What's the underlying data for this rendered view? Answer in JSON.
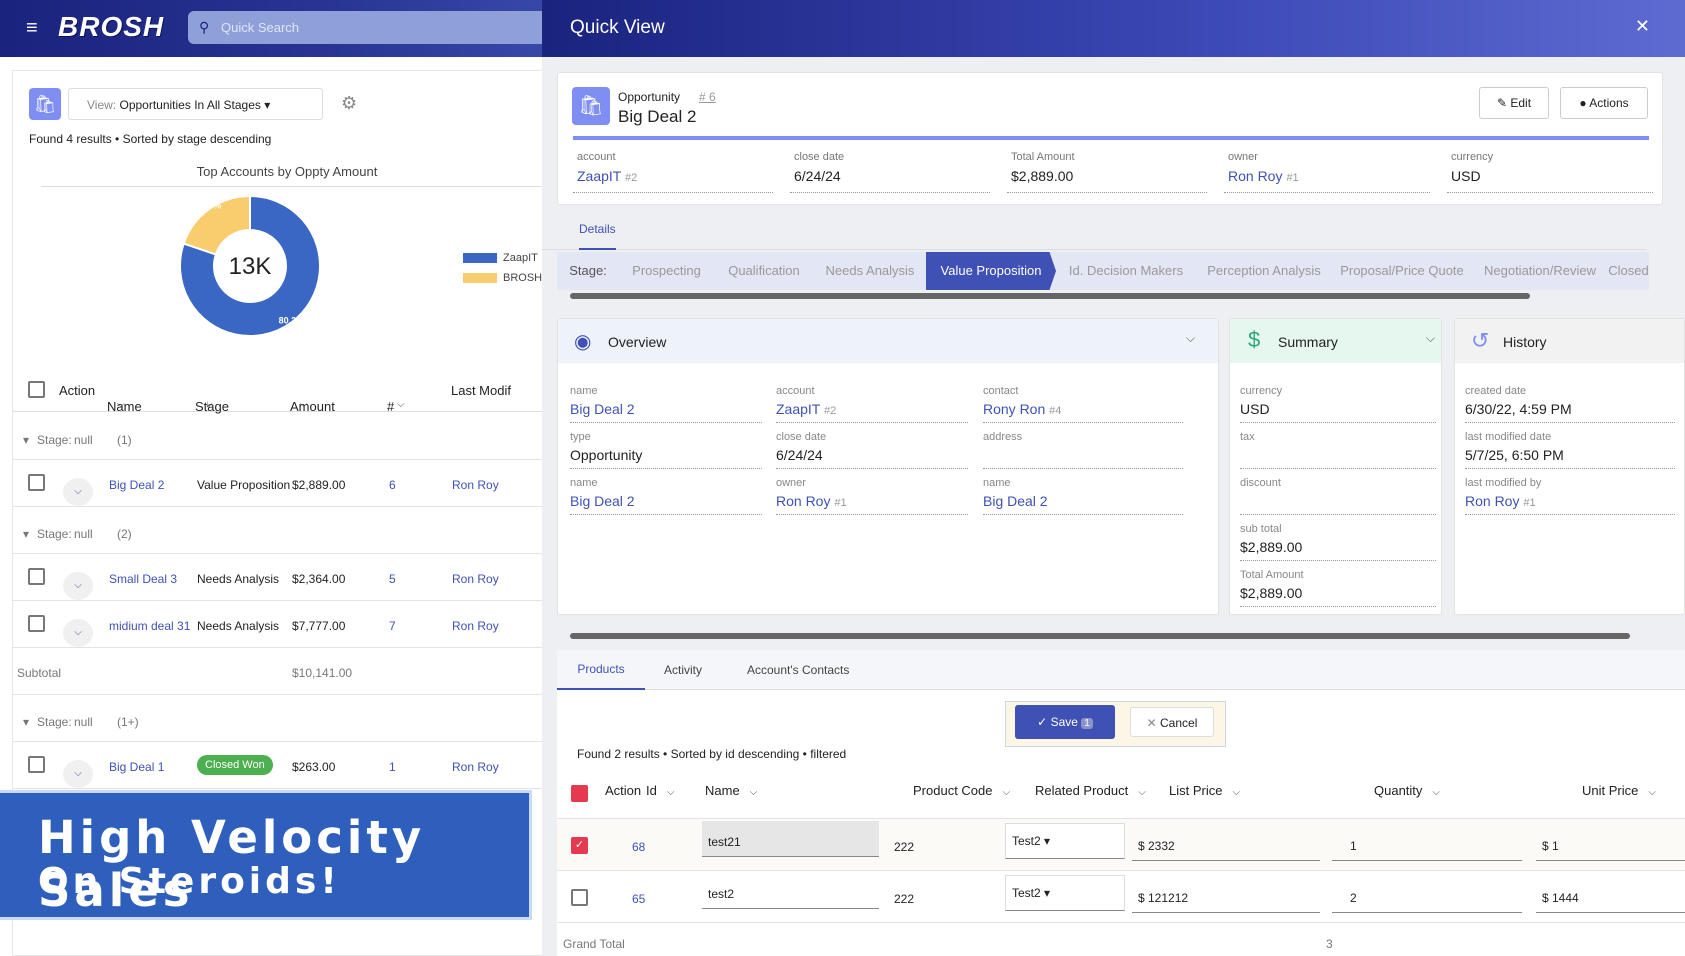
{
  "app": {
    "logo": "BROSH",
    "search_placeholder": "Quick Search"
  },
  "list": {
    "view_label": "View:",
    "view_value": "Opportunities In All Stages",
    "found": "Found 4 results • Sorted by stage descending",
    "chart_title": "Top Accounts by Oppty Amount",
    "headers": {
      "action": "Action",
      "name": "Name",
      "stage": "Stage",
      "amount": "Amount",
      "num": "#",
      "last": "Last Modif"
    },
    "groups": [
      {
        "label": "Stage:",
        "value": "null",
        "count": "(1)"
      },
      {
        "label": "Stage:",
        "value": "null",
        "count": "(2)"
      },
      {
        "label": "Stage:",
        "value": "null",
        "count": "(1+)"
      }
    ],
    "rows": [
      {
        "name": "Big Deal 2",
        "stage": "Value Proposition",
        "amount": "$2,889.00",
        "num": "6",
        "owner": "Ron Roy"
      },
      {
        "name": "Small Deal 3",
        "stage": "Needs Analysis",
        "amount": "$2,364.00",
        "num": "5",
        "owner": "Ron Roy"
      },
      {
        "name": "midium deal 31",
        "stage": "Needs Analysis",
        "amount": "$7,777.00",
        "num": "7",
        "owner": "Ron Roy"
      },
      {
        "name": "Big Deal 1",
        "stage": "Closed Won",
        "amount": "$263.00",
        "num": "1",
        "owner": "Ron Roy"
      }
    ],
    "subtotal_label": "Subtotal",
    "subtotal_value": "$10,141.00"
  },
  "chart_data": {
    "type": "pie",
    "title": "Top Accounts by Oppty Amount",
    "center_label": "13K",
    "categories": [
      "ZaapIT",
      "BROSH"
    ],
    "values": [
      80.2,
      19.8
    ],
    "value_labels": [
      "80.2%",
      "19.8%"
    ],
    "colors": [
      "#3a66c4",
      "#f9cc6e"
    ],
    "legend_position": "right"
  },
  "banner": {
    "line1": "High Velocity Sales",
    "line2": "On Steroids!"
  },
  "quickview": {
    "title": "Quick View",
    "type": "Opportunity",
    "id": "# 6",
    "name": "Big Deal 2",
    "edit": "Edit",
    "actions": "Actions",
    "fields": [
      {
        "label": "account",
        "value": "ZaapIT",
        "ref": "#2"
      },
      {
        "label": "close date",
        "value": "6/24/24",
        "ref": ""
      },
      {
        "label": "Total Amount",
        "value": "$2,889.00",
        "ref": ""
      },
      {
        "label": "owner",
        "value": "Ron Roy",
        "ref": "#1"
      },
      {
        "label": "currency",
        "value": "USD",
        "ref": ""
      }
    ],
    "details_tab": "Details",
    "stage_label": "Stage:",
    "stages": [
      "Prospecting",
      "Qualification",
      "Needs Analysis",
      "Value Proposition",
      "Id. Decision Makers",
      "Perception Analysis",
      "Proposal/Price Quote",
      "Negotiation/Review",
      "Closed"
    ],
    "overview": {
      "title": "Overview",
      "fields": [
        {
          "label": "name",
          "value": "Big Deal 2",
          "ref": ""
        },
        {
          "label": "account",
          "value": "ZaapIT",
          "ref": "#2"
        },
        {
          "label": "contact",
          "value": "Rony Ron",
          "ref": "#4"
        },
        {
          "label": "type",
          "value": "Opportunity",
          "ref": ""
        },
        {
          "label": "close date",
          "value": "6/24/24",
          "ref": ""
        },
        {
          "label": "address",
          "value": "",
          "ref": ""
        },
        {
          "label": "name",
          "value": "Big Deal 2",
          "ref": ""
        },
        {
          "label": "owner",
          "value": "Ron Roy",
          "ref": "#1"
        },
        {
          "label": "name",
          "value": "Big Deal 2",
          "ref": ""
        }
      ]
    },
    "summary": {
      "title": "Summary",
      "fields": [
        {
          "label": "currency",
          "value": "USD"
        },
        {
          "label": "tax",
          "value": ""
        },
        {
          "label": "discount",
          "value": ""
        },
        {
          "label": "sub total",
          "value": "$2,889.00"
        },
        {
          "label": "Total Amount",
          "value": "$2,889.00"
        }
      ]
    },
    "history": {
      "title": "History",
      "fields": [
        {
          "label": "created date",
          "value": "6/30/22, 4:59 PM",
          "ref": ""
        },
        {
          "label": "last modified date",
          "value": "5/7/25, 6:50 PM",
          "ref": ""
        },
        {
          "label": "last modified by",
          "value": "Ron Roy",
          "ref": "#1"
        }
      ]
    },
    "product_tabs": [
      "Products",
      "Activity",
      "Account's Contacts"
    ],
    "save": "Save",
    "save_count": "1",
    "cancel": "Cancel",
    "products_found": "Found 2 results • Sorted by id descending • filtered",
    "product_headers": {
      "action": "Action",
      "id": "Id",
      "name": "Name",
      "code": "Product Code",
      "related": "Related Product",
      "list": "List Price",
      "qty": "Quantity",
      "unit": "Unit Price"
    },
    "products": [
      {
        "id": "68",
        "name": "test21",
        "code": "222",
        "related": "Test2",
        "list": "$ 2332",
        "qty": "1",
        "unit": "$ 1"
      },
      {
        "id": "65",
        "name": "test2",
        "code": "222",
        "related": "Test2",
        "list": "$ 121212",
        "qty": "2",
        "unit": "$ 1444"
      }
    ],
    "grand_total_label": "Grand Total",
    "grand_total_qty": "3"
  }
}
